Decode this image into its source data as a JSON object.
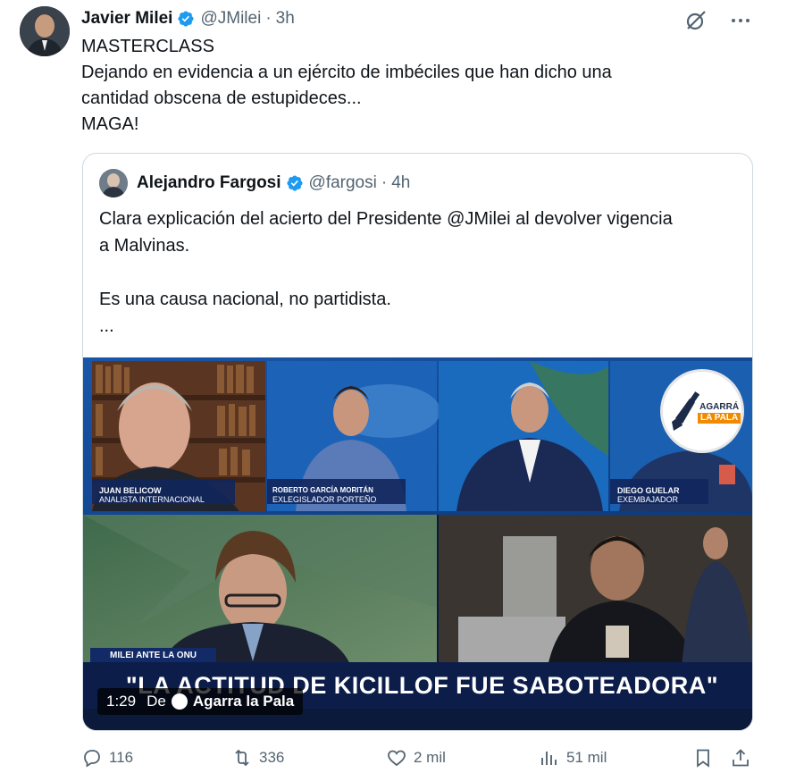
{
  "author": {
    "name": "Javier Milei",
    "handle": "@JMilei",
    "time": "3h"
  },
  "tweet": {
    "lines": [
      "MASTERCLASS",
      "Dejando en evidencia a un ejército de imbéciles que han dicho una",
      "cantidad obscena de estupideces...",
      "MAGA!"
    ]
  },
  "quote": {
    "name": "Alejandro Fargosi",
    "handle": "@fargosi",
    "time": "4h",
    "lines": [
      "Clara explicación del acierto del Presidente @JMilei al devolver vigencia",
      "a Malvinas.",
      "",
      "Es una causa nacional, no partidista.",
      "..."
    ]
  },
  "video": {
    "panels": [
      {
        "name": "JUAN BELICOW",
        "role": "ANALISTA INTERNACIONAL"
      },
      {
        "name": "ROBERTO GARCÍA MORITÁN",
        "role": "EXLEGISLADOR PORTEÑO"
      },
      {
        "name": "DIEGO GUELAR",
        "role": "EXEMBAJADOR"
      }
    ],
    "onu_label": "MILEI ANTE LA ONU",
    "caption": "\"LA ACTITUD DE KICILLOF FUE SABOTEADORA\"",
    "duration": "1:29",
    "from_label": "De",
    "source": "Agarra la Pala",
    "logo_top": "AGARRÁ",
    "logo_bottom": "LA PALA"
  },
  "actions": {
    "replies": "116",
    "reposts": "336",
    "likes": "2 mil",
    "views": "51 mil"
  },
  "colors": {
    "verified": "#1d9bf0",
    "muted": "#536471",
    "border": "#cfd9de",
    "caption_bar": "#0c1d4a",
    "logo_orange": "#f08a00"
  },
  "icons": [
    "verified-badge-icon",
    "grok-icon",
    "more-icon",
    "reply-icon",
    "repost-icon",
    "like-icon",
    "views-icon",
    "bookmark-icon",
    "share-icon"
  ]
}
